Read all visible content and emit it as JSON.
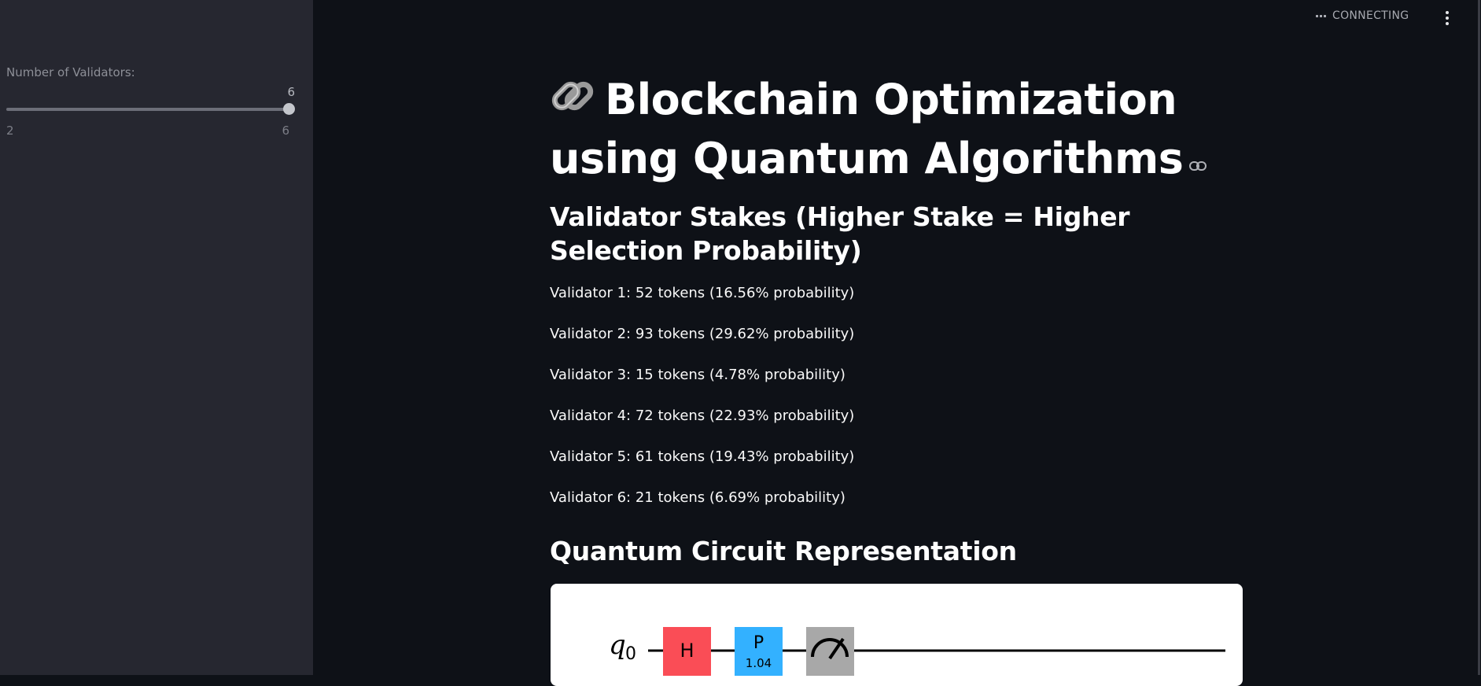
{
  "sidebar": {
    "slider": {
      "label": "Number of Validators:",
      "value": "6",
      "min": "2",
      "max": "6"
    }
  },
  "topbar": {
    "status": "CONNECTING",
    "status_icon": "ellipsis-icon",
    "menu_icon": "kebab-menu-icon"
  },
  "main": {
    "title": "Blockchain Optimization using Quantum Algorithms",
    "title_icon": "link-chain-icon",
    "stakes_heading": "Validator Stakes (Higher Stake = Higher Selection Probability)",
    "validators": [
      "Validator 1: 52 tokens (16.56% probability)",
      "Validator 2: 93 tokens (29.62% probability)",
      "Validator 3: 15 tokens (4.78% probability)",
      "Validator 4: 72 tokens (22.93% probability)",
      "Validator 5: 61 tokens (19.43% probability)",
      "Validator 6: 21 tokens (6.69% probability)"
    ],
    "circuit_heading": "Quantum Circuit Representation",
    "circuit": {
      "qubit_label": "q",
      "qubit_index": "0",
      "gates": [
        {
          "label": "H",
          "param": "",
          "color": "#fa4d56"
        },
        {
          "label": "P",
          "param": "1.04",
          "color": "#33b1ff"
        },
        {
          "label": "",
          "param": "",
          "color": "#a8a8a8"
        }
      ]
    }
  },
  "colors": {
    "background": "#0e1117",
    "sidebar": "#262730",
    "text": "#ffffff"
  }
}
